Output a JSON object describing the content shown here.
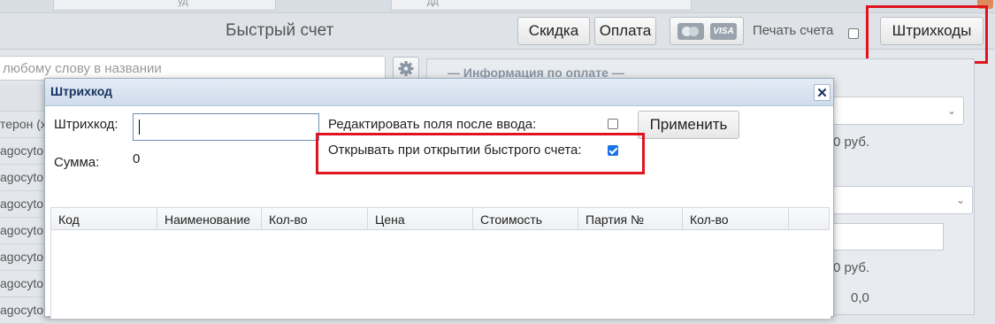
{
  "top_tabs": {
    "left_partial": "уд",
    "right_partial": "дд"
  },
  "header": {
    "title": "Быстрый счет",
    "discount_label": "Скидка",
    "payment_label": "Оплата",
    "visa_label": "VISA",
    "print_label": "Печать счета",
    "barcodes_label": "Штрихкоды"
  },
  "background": {
    "search_placeholder": "любому слову в названии",
    "payment_info_title": "— Информация по оплате —",
    "rub1": "0 руб.",
    "rub2": "0 руб.",
    "partial_value": "0,0",
    "list_items": [
      "терон (х",
      "agocyto",
      "agocyto",
      "agocyto",
      "agocyto",
      "agocyto",
      "agocyto",
      "agocyto"
    ]
  },
  "dialog": {
    "title": "Штрихкод",
    "barcode_label": "Штрихкод:",
    "barcode_value": "",
    "sum_label": "Сумма:",
    "sum_value": "0",
    "edit_after_input_label": "Редактировать поля после ввода:",
    "edit_after_input_checked": false,
    "open_on_quick_invoice_label": "Открывать при открытии быстрого счета:",
    "open_on_quick_invoice_checked": true,
    "apply_label": "Применить",
    "columns": [
      "Код",
      "Наименование",
      "Кол-во",
      "Цена",
      "Стоимость",
      "Партия №",
      "Кол-во",
      ""
    ]
  },
  "colors": {
    "highlight": "#e0141e",
    "checkbox_checked": "#1a73e8",
    "dialog_title": "#15325f"
  }
}
